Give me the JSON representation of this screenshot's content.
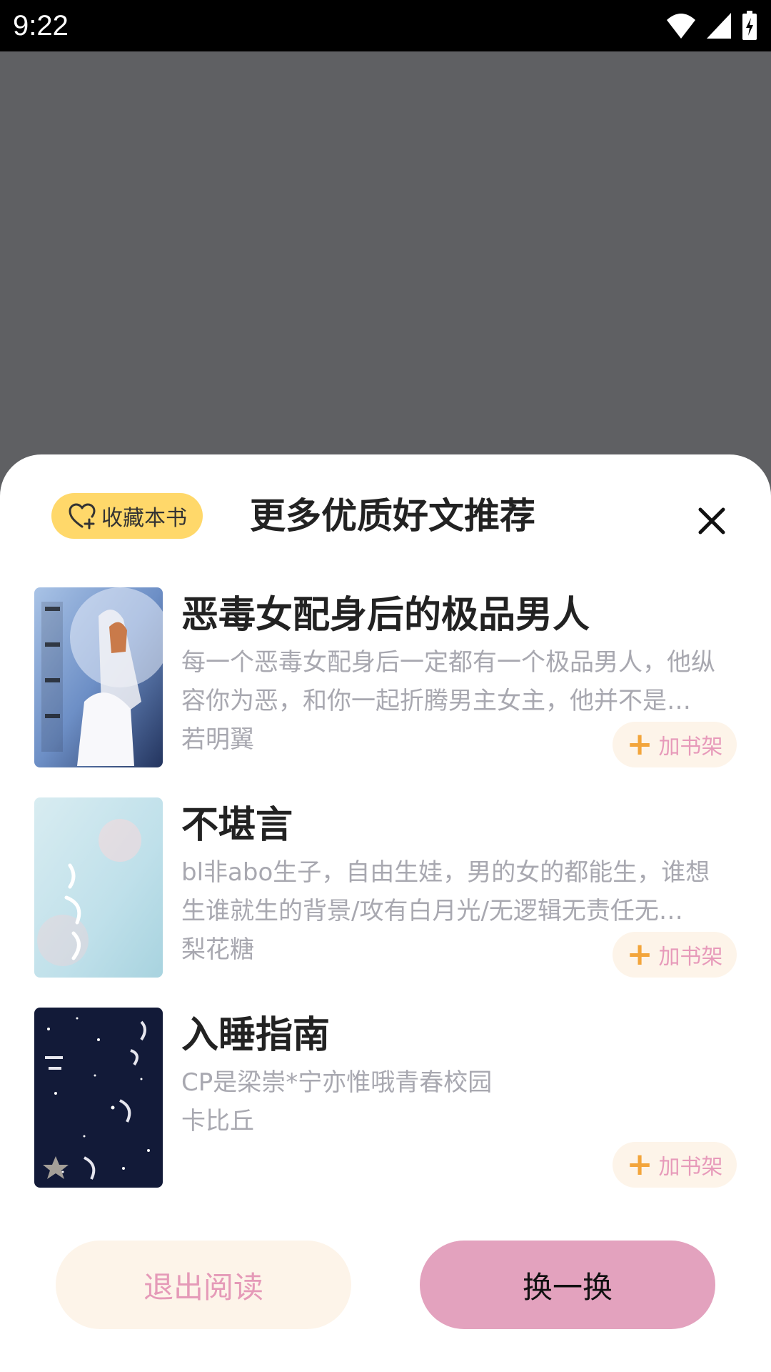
{
  "status_bar": {
    "time": "9:22"
  },
  "sheet": {
    "favorite_label": "收藏本书",
    "title": "更多优质好文推荐",
    "books": [
      {
        "title": "恶毒女配身后的极品男人",
        "description": "每一个恶毒女配身后一定都有一个极品男人，他纵容你为恶，和你一起折腾男主女主，他并不是…",
        "author": "若明翼",
        "add_label": "加书架"
      },
      {
        "title": "不堪言",
        "description": "bl非abo生子，自由生娃，男的女的都能生，谁想生谁就生的背景/攻有白月光/无逻辑无责任无…",
        "author": "梨花糖",
        "add_label": "加书架"
      },
      {
        "title": "入睡指南",
        "description": "CP是梁崇*宁亦惟哦青春校园",
        "author": "卡比丘",
        "add_label": "加书架"
      }
    ],
    "exit_label": "退出阅读",
    "swap_label": "换一换"
  },
  "colors": {
    "overlay": "#5f6063",
    "favorite_bg": "#ffd86a",
    "add_bg": "#fdf4e9",
    "add_plus": "#f3a53b",
    "pink_text": "#e59ab8",
    "swap_bg": "#e3a2be"
  },
  "icons": [
    "wifi-icon",
    "signal-icon",
    "battery-icon",
    "heart-plus-icon",
    "close-icon",
    "plus-icon"
  ]
}
